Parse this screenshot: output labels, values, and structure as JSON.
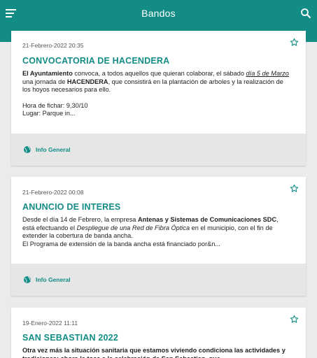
{
  "appbar": {
    "title": "Bandos",
    "menu_icon": "menu-icon",
    "search_icon": "search-icon",
    "color": "#138c86"
  },
  "cards": [
    {
      "date": "21-Febrero-2022 20:35",
      "title": "CONVOCATORIA DE HACENDERA",
      "body": {
        "p1_bold": "El Ayuntamiento",
        "p1_a": " convoca, a todos aquellos que quieran colaborar,  el sábado ",
        "p1_italic": "día 5 de Marzo",
        "p1_b": " una jornada de ",
        "p1_bold2": "HACENDERA",
        "p1_c": ", que consistirá en la plantación de arboles y la realización de los hoyos necesarios para ello.",
        "line2": "Hora de fichar: 9,30/10",
        "line3": "Lugar: Parque in..."
      },
      "tag": "Info General"
    },
    {
      "date": "21-Febrero-2022 00:08",
      "title": "ANUNCIO DE INTERES",
      "body": {
        "p1_a": "Desde el día 14 de Febrero, la empresa  ",
        "p1_bold": "Antenas y Sistemas de Comunicaciones SDC",
        "p1_b": ", está efectuando el ",
        "p1_italic": "Despliegue de una Red de Fibra Óptica",
        "p1_c": " en el municipio, con el fin de extender la cobertura de banda ancha.",
        "line2": "El Programa de extensión de la banda ancha está financiado por&n..."
      },
      "tag": "Info General"
    },
    {
      "date": "19-Enero-2022 11:11",
      "title": "SAN SEBASTIAN 2022",
      "body": {
        "p1_bold": "Otra vez más la situación sanitaria que estamos viviendo condiciona las actividades y tradiciones; ahora le toca a la celebración de San Sebastian, que"
      }
    }
  ]
}
